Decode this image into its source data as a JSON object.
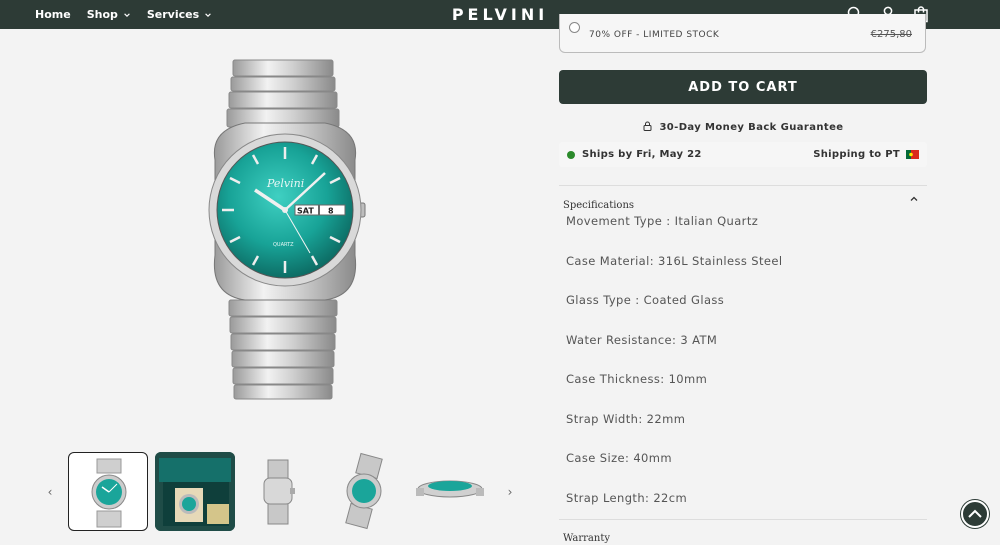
{
  "header": {
    "nav": [
      {
        "label": "Home"
      },
      {
        "label": "Shop"
      },
      {
        "label": "Services"
      }
    ],
    "logo": "PELVINI",
    "icons": [
      "search-icon",
      "account-icon",
      "cart-icon"
    ]
  },
  "offer": {
    "label": "70% OFF - LIMITED STOCK",
    "price": "€275,80"
  },
  "add_to_cart_label": "ADD TO CART",
  "guarantee": "30-Day Money Back Guarantee",
  "shipping": {
    "ships_by": "Ships by Fri, May 22",
    "shipping_to": "Shipping to PT"
  },
  "specifications": {
    "title": "Specifications",
    "items": [
      "Movement Type : Italian Quartz",
      "Case Material: 316L Stainless Steel",
      "Glass Type : Coated Glass",
      "Water Resistance: 3 ATM",
      "Case Thickness: 10mm",
      "Strap Width: 22mm",
      "Case Size: 40mm",
      "Strap Length: 22cm"
    ]
  },
  "warranty_title": "Warranty",
  "colors": {
    "brand": "#2d3b36",
    "dial": "#1aa59a",
    "status_green": "#2b8a2b"
  }
}
